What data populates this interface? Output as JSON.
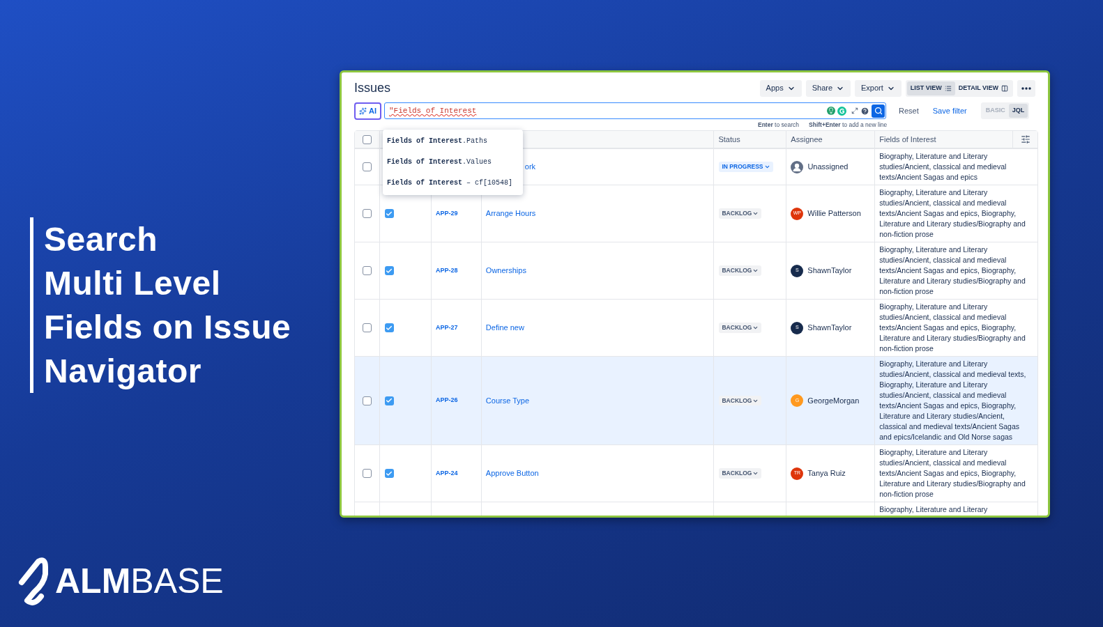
{
  "headline_lines": [
    "Search",
    "Multi Level",
    "Fields on Issue",
    "Navigator"
  ],
  "logo": {
    "bold": "ALM",
    "light": "BASE"
  },
  "window": {
    "title": "Issues",
    "actions": [
      {
        "label": "Apps"
      },
      {
        "label": "Share"
      },
      {
        "label": "Export"
      }
    ],
    "views": [
      {
        "label": "LIST VIEW",
        "kind": "list",
        "selected": true
      },
      {
        "label": "DETAIL VIEW",
        "kind": "detail",
        "selected": false
      }
    ]
  },
  "search": {
    "ai_label": "AI",
    "query": "\"Fields of Interest",
    "reset": "Reset",
    "save": "Save filter",
    "hints": [
      "**Enter** to search",
      "**Shift+Enter** to add a new line"
    ],
    "modes": [
      {
        "label": "BASIC",
        "selected": false
      },
      {
        "label": "JQL",
        "selected": true
      }
    ]
  },
  "suggestions": [
    "**Fields of Interest**.Paths",
    "**Fields of Interest**.Values",
    "**Fields of Interest** – cf[10548]"
  ],
  "table": {
    "header_checked": false,
    "columns": [
      "Status",
      "Assignee",
      "Fields of Interest"
    ],
    "rows": [
      {
        "selected": false,
        "summary": "ork",
        "status": {
          "label": "IN PROGRESS",
          "kind": "in_progress"
        },
        "assignee": {
          "name": "Unassigned",
          "kind": "unassigned"
        },
        "fields": "Biography, Literature and Literary studies/Ancient, classical and medieval texts/Ancient Sagas and epics",
        "highlighted": false
      },
      {
        "selected": false,
        "checked": true,
        "key": "APP-29",
        "summary": "Arrange Hours",
        "status": {
          "label": "BACKLOG",
          "kind": "backlog"
        },
        "assignee": {
          "name": "Willie Patterson",
          "kind": "user",
          "initials": "WP",
          "color": "#de350b"
        },
        "fields": "Biography, Literature and Literary studies/Ancient, classical and medieval texts/Ancient Sagas and epics, Biography, Literature and Literary studies/Biography and non-fiction prose",
        "highlighted": false
      },
      {
        "selected": false,
        "checked": true,
        "key": "APP-28",
        "summary": "Ownerships",
        "status": {
          "label": "BACKLOG",
          "kind": "backlog"
        },
        "assignee": {
          "name": "ShawnTaylor",
          "kind": "user",
          "initials": "S",
          "color": "#172b4d"
        },
        "fields": "Biography, Literature and Literary studies/Ancient, classical and medieval texts/Ancient Sagas and epics, Biography, Literature and Literary studies/Biography and non-fiction prose",
        "highlighted": false
      },
      {
        "selected": false,
        "checked": true,
        "key": "APP-27",
        "summary": "Define new",
        "status": {
          "label": "BACKLOG",
          "kind": "backlog"
        },
        "assignee": {
          "name": "ShawnTaylor",
          "kind": "user",
          "initials": "S",
          "color": "#172b4d"
        },
        "fields": "Biography, Literature and Literary studies/Ancient, classical and medieval texts/Ancient Sagas and epics, Biography, Literature and Literary studies/Biography and non-fiction prose",
        "highlighted": false
      },
      {
        "selected": false,
        "checked": true,
        "key": "APP-26",
        "summary": "Course Type",
        "status": {
          "label": "BACKLOG",
          "kind": "backlog"
        },
        "assignee": {
          "name": "GeorgeMorgan",
          "kind": "user",
          "initials": "G",
          "color": "#ff991f"
        },
        "fields": "Biography, Literature and Literary studies/Ancient, classical and medieval texts, Biography, Literature and Literary studies/Ancient, classical and medieval texts/Ancient Sagas and epics, Biography, Literature and Literary studies/Ancient, classical and medieval texts/Ancient Sagas and epics/Icelandic and Old Norse sagas",
        "highlighted": true
      },
      {
        "selected": false,
        "checked": true,
        "key": "APP-24",
        "summary": "Approve Button",
        "status": {
          "label": "BACKLOG",
          "kind": "backlog"
        },
        "assignee": {
          "name": "Tanya Ruiz",
          "kind": "user",
          "initials": "TR",
          "color": "#de350b"
        },
        "fields": "Biography, Literature and Literary studies/Ancient, classical and medieval texts/Ancient Sagas and epics, Biography, Literature and Literary studies/Biography and non-fiction prose",
        "highlighted": false
      },
      {
        "fields": "Biography, Literature and Literary",
        "highlighted": false
      }
    ]
  }
}
